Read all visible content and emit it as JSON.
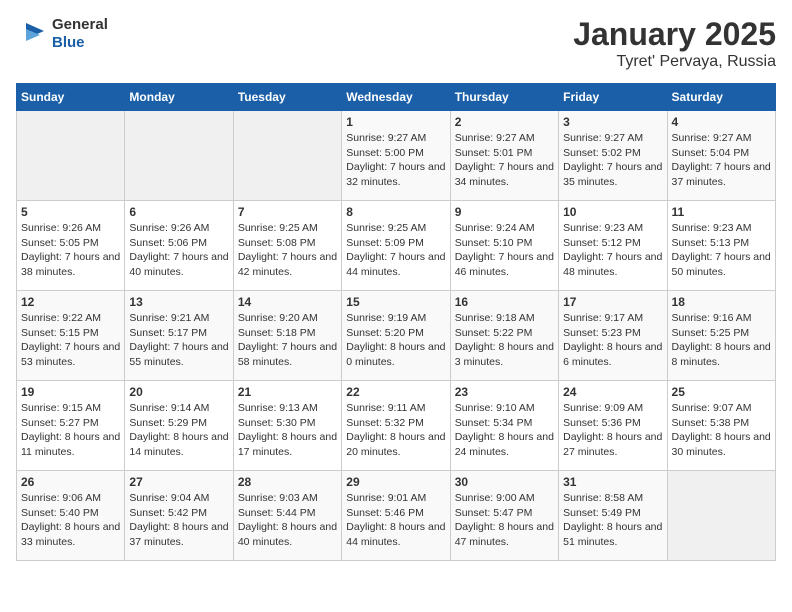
{
  "logo": {
    "general": "General",
    "blue": "Blue"
  },
  "title": "January 2025",
  "subtitle": "Tyret' Pervaya, Russia",
  "weekdays": [
    "Sunday",
    "Monday",
    "Tuesday",
    "Wednesday",
    "Thursday",
    "Friday",
    "Saturday"
  ],
  "weeks": [
    [
      {
        "day": "",
        "empty": true
      },
      {
        "day": "",
        "empty": true
      },
      {
        "day": "",
        "empty": true
      },
      {
        "day": "1",
        "sunrise": "9:27 AM",
        "sunset": "5:00 PM",
        "daylight": "7 hours and 32 minutes."
      },
      {
        "day": "2",
        "sunrise": "9:27 AM",
        "sunset": "5:01 PM",
        "daylight": "7 hours and 34 minutes."
      },
      {
        "day": "3",
        "sunrise": "9:27 AM",
        "sunset": "5:02 PM",
        "daylight": "7 hours and 35 minutes."
      },
      {
        "day": "4",
        "sunrise": "9:27 AM",
        "sunset": "5:04 PM",
        "daylight": "7 hours and 37 minutes."
      }
    ],
    [
      {
        "day": "5",
        "sunrise": "9:26 AM",
        "sunset": "5:05 PM",
        "daylight": "7 hours and 38 minutes."
      },
      {
        "day": "6",
        "sunrise": "9:26 AM",
        "sunset": "5:06 PM",
        "daylight": "7 hours and 40 minutes."
      },
      {
        "day": "7",
        "sunrise": "9:25 AM",
        "sunset": "5:08 PM",
        "daylight": "7 hours and 42 minutes."
      },
      {
        "day": "8",
        "sunrise": "9:25 AM",
        "sunset": "5:09 PM",
        "daylight": "7 hours and 44 minutes."
      },
      {
        "day": "9",
        "sunrise": "9:24 AM",
        "sunset": "5:10 PM",
        "daylight": "7 hours and 46 minutes."
      },
      {
        "day": "10",
        "sunrise": "9:23 AM",
        "sunset": "5:12 PM",
        "daylight": "7 hours and 48 minutes."
      },
      {
        "day": "11",
        "sunrise": "9:23 AM",
        "sunset": "5:13 PM",
        "daylight": "7 hours and 50 minutes."
      }
    ],
    [
      {
        "day": "12",
        "sunrise": "9:22 AM",
        "sunset": "5:15 PM",
        "daylight": "7 hours and 53 minutes."
      },
      {
        "day": "13",
        "sunrise": "9:21 AM",
        "sunset": "5:17 PM",
        "daylight": "7 hours and 55 minutes."
      },
      {
        "day": "14",
        "sunrise": "9:20 AM",
        "sunset": "5:18 PM",
        "daylight": "7 hours and 58 minutes."
      },
      {
        "day": "15",
        "sunrise": "9:19 AM",
        "sunset": "5:20 PM",
        "daylight": "8 hours and 0 minutes."
      },
      {
        "day": "16",
        "sunrise": "9:18 AM",
        "sunset": "5:22 PM",
        "daylight": "8 hours and 3 minutes."
      },
      {
        "day": "17",
        "sunrise": "9:17 AM",
        "sunset": "5:23 PM",
        "daylight": "8 hours and 6 minutes."
      },
      {
        "day": "18",
        "sunrise": "9:16 AM",
        "sunset": "5:25 PM",
        "daylight": "8 hours and 8 minutes."
      }
    ],
    [
      {
        "day": "19",
        "sunrise": "9:15 AM",
        "sunset": "5:27 PM",
        "daylight": "8 hours and 11 minutes."
      },
      {
        "day": "20",
        "sunrise": "9:14 AM",
        "sunset": "5:29 PM",
        "daylight": "8 hours and 14 minutes."
      },
      {
        "day": "21",
        "sunrise": "9:13 AM",
        "sunset": "5:30 PM",
        "daylight": "8 hours and 17 minutes."
      },
      {
        "day": "22",
        "sunrise": "9:11 AM",
        "sunset": "5:32 PM",
        "daylight": "8 hours and 20 minutes."
      },
      {
        "day": "23",
        "sunrise": "9:10 AM",
        "sunset": "5:34 PM",
        "daylight": "8 hours and 24 minutes."
      },
      {
        "day": "24",
        "sunrise": "9:09 AM",
        "sunset": "5:36 PM",
        "daylight": "8 hours and 27 minutes."
      },
      {
        "day": "25",
        "sunrise": "9:07 AM",
        "sunset": "5:38 PM",
        "daylight": "8 hours and 30 minutes."
      }
    ],
    [
      {
        "day": "26",
        "sunrise": "9:06 AM",
        "sunset": "5:40 PM",
        "daylight": "8 hours and 33 minutes."
      },
      {
        "day": "27",
        "sunrise": "9:04 AM",
        "sunset": "5:42 PM",
        "daylight": "8 hours and 37 minutes."
      },
      {
        "day": "28",
        "sunrise": "9:03 AM",
        "sunset": "5:44 PM",
        "daylight": "8 hours and 40 minutes."
      },
      {
        "day": "29",
        "sunrise": "9:01 AM",
        "sunset": "5:46 PM",
        "daylight": "8 hours and 44 minutes."
      },
      {
        "day": "30",
        "sunrise": "9:00 AM",
        "sunset": "5:47 PM",
        "daylight": "8 hours and 47 minutes."
      },
      {
        "day": "31",
        "sunrise": "8:58 AM",
        "sunset": "5:49 PM",
        "daylight": "8 hours and 51 minutes."
      },
      {
        "day": "",
        "empty": true
      }
    ]
  ],
  "labels": {
    "sunrise": "Sunrise:",
    "sunset": "Sunset:",
    "daylight": "Daylight:"
  }
}
